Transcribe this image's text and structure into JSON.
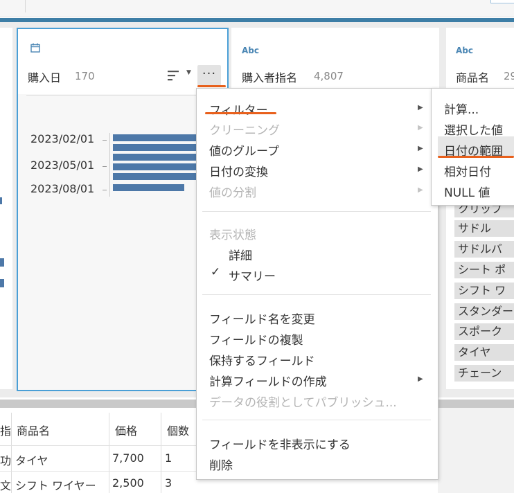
{
  "profile": {
    "selected_card": {
      "icon": "calendar-icon",
      "title": "購入日",
      "count": "170",
      "axis_labels": [
        "2023/02/01",
        "2023/05/01",
        "2023/08/01"
      ],
      "bar_color": "#4d78a8",
      "border_color": "#4a9fd6",
      "more_label": "···"
    },
    "card2": {
      "type_label": "Abc",
      "title": "購入者指名",
      "count": "4,807"
    },
    "card3": {
      "type_label": "Abc",
      "title": "商品名",
      "count": "29",
      "values": [
        "クリップ",
        "サドル",
        "サドルバ",
        "シート ポ",
        "シフト ワ",
        "スタンダー",
        "スポーク",
        "タイヤ",
        "チェーン"
      ]
    }
  },
  "context_menu": {
    "items": [
      {
        "label": "フィルター",
        "submenu": true,
        "enabled": true
      },
      {
        "label": "クリーニング",
        "submenu": true,
        "enabled": false
      },
      {
        "label": "値のグループ",
        "submenu": true,
        "enabled": true
      },
      {
        "label": "日付の変換",
        "submenu": true,
        "enabled": true
      },
      {
        "label": "値の分割",
        "submenu": true,
        "enabled": false
      }
    ],
    "view_state_header": "表示状態",
    "view_detail": "詳細",
    "view_summary": "サマリー",
    "checked_view": "サマリー",
    "field_items": [
      {
        "label": "フィールド名を変更",
        "enabled": true
      },
      {
        "label": "フィールドの複製",
        "enabled": true
      },
      {
        "label": "保持するフィールド",
        "enabled": true
      },
      {
        "label": "計算フィールドの作成",
        "enabled": true,
        "submenu": true
      },
      {
        "label": "データの役割としてパブリッシュ...",
        "enabled": false
      }
    ],
    "hide_field": "フィールドを非表示にする",
    "delete": "削除"
  },
  "filter_submenu": {
    "items": [
      "計算...",
      "選択した値",
      "日付の範囲",
      "相対日付",
      "NULL 値"
    ],
    "highlighted": "日付の範囲"
  },
  "table": {
    "headers": [
      "指",
      "商品名",
      "価格",
      "個数"
    ],
    "rows": [
      [
        "功",
        "タイヤ",
        "7,700",
        "1"
      ],
      [
        "文",
        "シフト ワイヤー",
        "2,500",
        "3"
      ]
    ]
  },
  "colors": {
    "accent_underline": "#e8601c",
    "header_bar": "#3d7ea6"
  }
}
